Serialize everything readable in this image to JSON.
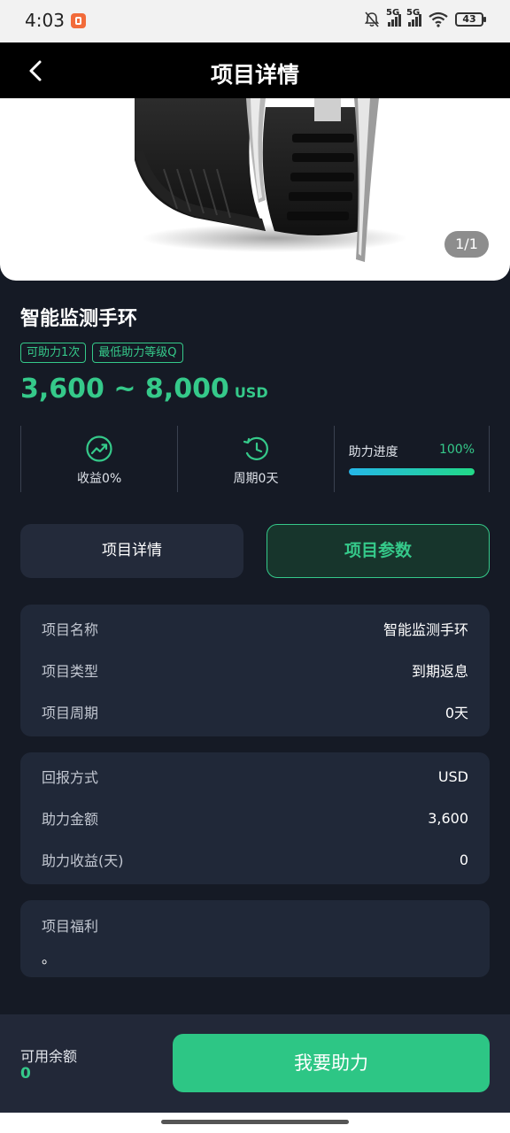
{
  "status_bar": {
    "time": "4:03",
    "network_1": "5G",
    "network_2": "5G",
    "battery": "43"
  },
  "header": {
    "title": "项目详情"
  },
  "gallery": {
    "counter": "1/1"
  },
  "product": {
    "name": "智能监测手环",
    "tags": [
      "可助力1次",
      "最低助力等级Q"
    ],
    "price_range": "3,600 ~ 8,000",
    "price_unit": "USD"
  },
  "stats": {
    "yield_label": "收益0%",
    "cycle_label": "周期0天",
    "progress_label": "助力进度",
    "progress_value": "100%",
    "progress_fraction": 1.0
  },
  "tabs": {
    "details": "项目详情",
    "params": "项目参数"
  },
  "card_1": {
    "rows": [
      {
        "label": "项目名称",
        "value": "智能监测手环"
      },
      {
        "label": "项目类型",
        "value": "到期返息"
      },
      {
        "label": "项目周期",
        "value": "0天"
      }
    ]
  },
  "card_2": {
    "rows": [
      {
        "label": "回报方式",
        "value": "USD"
      },
      {
        "label": "助力金额",
        "value": "3,600"
      },
      {
        "label": "助力收益(天)",
        "value": "0"
      }
    ]
  },
  "benefits": {
    "title": "项目福利",
    "text": "。"
  },
  "bottom": {
    "balance_label": "可用余额",
    "balance_value": "0",
    "support_button": "我要助力"
  },
  "colors": {
    "accent": "#35c98a",
    "background": "#151a25",
    "card": "#202838"
  }
}
